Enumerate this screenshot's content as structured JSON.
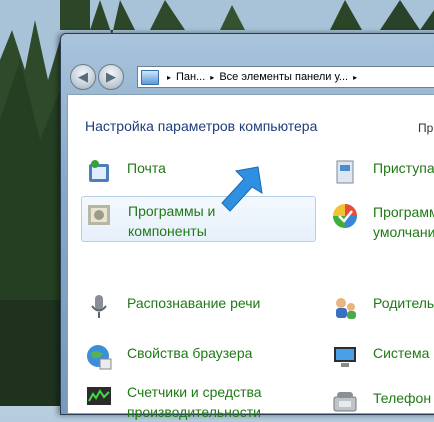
{
  "window": {
    "breadcrumb": [
      "Пан...",
      "Все элементы панели у...",
      ""
    ]
  },
  "header": {
    "title": "Настройка параметров компьютера",
    "right_fragment": "Пр"
  },
  "left_items": [
    {
      "label": "Почта",
      "icon": "mail-icon"
    },
    {
      "label": "Программы и\nкомпоненты",
      "icon": "programs-icon",
      "selected": true
    },
    {
      "label": "Распознавание речи",
      "icon": "microphone-icon"
    },
    {
      "label": "Свойства браузера",
      "icon": "internet-options-icon"
    },
    {
      "label": "Счетчики и средства\nпроизводительности",
      "icon": "performance-icon"
    }
  ],
  "right_items": [
    {
      "label": "Приступа",
      "icon": "getting-started-icon"
    },
    {
      "label": "Программ\nумолчани",
      "icon": "default-programs-icon"
    },
    {
      "label": "Родитель",
      "icon": "parental-controls-icon"
    },
    {
      "label": "Система",
      "icon": "system-icon"
    },
    {
      "label": "Телефон",
      "icon": "phone-modem-icon"
    }
  ],
  "colors": {
    "link": "#1e7a14",
    "heading": "#1e3d7b",
    "arrow": "#2f8fe0"
  }
}
